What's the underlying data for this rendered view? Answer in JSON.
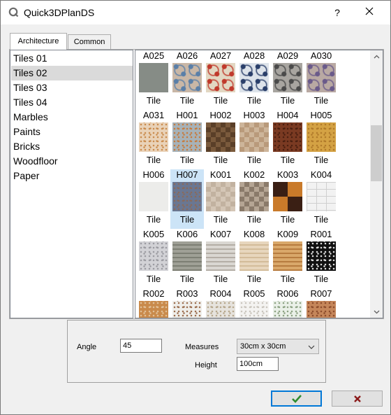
{
  "window": {
    "title": "Quick3DPlanDS",
    "help_label": "?"
  },
  "tabs": [
    {
      "label": "Architecture",
      "active": true
    },
    {
      "label": "Common",
      "active": false
    }
  ],
  "categories": [
    {
      "label": "Tiles 01",
      "selected": false
    },
    {
      "label": "Tiles 02",
      "selected": true
    },
    {
      "label": "Tiles 03",
      "selected": false
    },
    {
      "label": "Tiles 04",
      "selected": false
    },
    {
      "label": "Marbles",
      "selected": false
    },
    {
      "label": "Paints",
      "selected": false
    },
    {
      "label": "Bricks",
      "selected": false
    },
    {
      "label": "Woodfloor",
      "selected": false
    },
    {
      "label": "Paper",
      "selected": false
    }
  ],
  "grid": {
    "rows": [
      {
        "items": [
          {
            "code": "A025",
            "caption": "Tile",
            "color": "#868c86",
            "pattern": "plain",
            "selected": false
          },
          {
            "code": "A026",
            "caption": "Tile",
            "color": "#c9b7a6",
            "pattern": "ornate",
            "accent": "#5a7fa8",
            "selected": false
          },
          {
            "code": "A027",
            "caption": "Tile",
            "color": "#e2d7c2",
            "pattern": "ornate",
            "accent": "#c0392b",
            "selected": false
          },
          {
            "code": "A028",
            "caption": "Tile",
            "color": "#dde3ea",
            "pattern": "ornate",
            "accent": "#2a3f6a",
            "selected": false
          },
          {
            "code": "A029",
            "caption": "Tile",
            "color": "#a8a5a0",
            "pattern": "ornate",
            "accent": "#4a4a4a",
            "selected": false
          },
          {
            "code": "A030",
            "caption": "Tile",
            "color": "#b9a9a3",
            "pattern": "ornate",
            "accent": "#6a5a8a",
            "selected": false
          }
        ]
      },
      {
        "items": [
          {
            "code": "A031",
            "caption": "Tile",
            "color": "#e9d2b8",
            "pattern": "speckle",
            "accent": "#c98a4b",
            "selected": false
          },
          {
            "code": "H001",
            "caption": "Tile",
            "color": "#a7b2b8",
            "pattern": "speckle",
            "accent": "#c77a3c",
            "selected": false
          },
          {
            "code": "H002",
            "caption": "Tile",
            "color": "#7a5a3c",
            "pattern": "checker",
            "accent": "#5a3f28",
            "selected": false
          },
          {
            "code": "H003",
            "caption": "Tile",
            "color": "#cdb59a",
            "pattern": "checker",
            "accent": "#b99a7b",
            "selected": false
          },
          {
            "code": "H004",
            "caption": "Tile",
            "color": "#7a3a22",
            "pattern": "speckle",
            "accent": "#4a1f10",
            "selected": false
          },
          {
            "code": "H005",
            "caption": "Tile",
            "color": "#d4a244",
            "pattern": "speckle",
            "accent": "#b07a2a",
            "selected": false
          }
        ]
      },
      {
        "items": [
          {
            "code": "H006",
            "caption": "Tile",
            "color": "#ececea",
            "pattern": "plain",
            "selected": false
          },
          {
            "code": "H007",
            "caption": "Tile",
            "color": "#6a7792",
            "pattern": "speckle",
            "accent": "#8a6a5a",
            "selected": true
          },
          {
            "code": "K001",
            "caption": "Tile",
            "color": "#d4c6b6",
            "pattern": "checker",
            "accent": "#c2b2a0",
            "selected": false
          },
          {
            "code": "K002",
            "caption": "Tile",
            "color": "#b5a594",
            "pattern": "checker",
            "accent": "#8a7a6a",
            "selected": false
          },
          {
            "code": "K003",
            "caption": "Tile",
            "color": "#c97a2a",
            "pattern": "quad",
            "accent": "#3a1f14",
            "selected": false
          },
          {
            "code": "K004",
            "caption": "Tile",
            "color": "#f2f2f2",
            "pattern": "brick",
            "accent": "#cfcfcf",
            "selected": false
          }
        ]
      },
      {
        "items": [
          {
            "code": "K005",
            "caption": "Tile",
            "color": "#d2d2d6",
            "pattern": "speckle",
            "accent": "#9a9aa0",
            "selected": false
          },
          {
            "code": "K006",
            "caption": "Tile",
            "color": "#9fa096",
            "pattern": "stripes",
            "accent": "#7d7f74",
            "selected": false
          },
          {
            "code": "K007",
            "caption": "Tile",
            "color": "#dad7d2",
            "pattern": "stripes",
            "accent": "#b4aea6",
            "selected": false
          },
          {
            "code": "K008",
            "caption": "Tile",
            "color": "#e7d6bd",
            "pattern": "stripes",
            "accent": "#d3bc9a",
            "selected": false
          },
          {
            "code": "K009",
            "caption": "Tile",
            "color": "#d9a86a",
            "pattern": "stripes",
            "accent": "#b77c3f",
            "selected": false
          },
          {
            "code": "R001",
            "caption": "Tile",
            "color": "#111111",
            "pattern": "speckle",
            "accent": "#e5e5e5",
            "selected": false
          }
        ]
      },
      {
        "items": [
          {
            "code": "R002",
            "caption": "",
            "color": "#c98a4b",
            "pattern": "speckle",
            "accent": "#e2c29a",
            "selected": false
          },
          {
            "code": "R003",
            "caption": "",
            "color": "#efeeea",
            "pattern": "speckle",
            "accent": "#9a6a4a",
            "selected": false
          },
          {
            "code": "R004",
            "caption": "",
            "color": "#e6e3dd",
            "pattern": "speckle",
            "accent": "#b5a58a",
            "selected": false
          },
          {
            "code": "R005",
            "caption": "",
            "color": "#f4f3f1",
            "pattern": "speckle",
            "accent": "#c9c4bc",
            "selected": false
          },
          {
            "code": "R006",
            "caption": "",
            "color": "#eaf0e8",
            "pattern": "speckle",
            "accent": "#8aa080",
            "selected": false
          },
          {
            "code": "R007",
            "caption": "",
            "color": "#c5865a",
            "pattern": "speckle",
            "accent": "#8a4a2a",
            "selected": false
          }
        ]
      }
    ]
  },
  "properties": {
    "angle_label": "Angle",
    "angle_value": "45",
    "measures_label": "Measures",
    "measures_value": "30cm x 30cm",
    "height_label": "Height",
    "height_value": "100cm"
  },
  "buttons": {
    "ok_icon": "check-icon",
    "ok_color": "#2e8b2e",
    "cancel_icon": "cross-icon",
    "cancel_color": "#8b1a1a"
  },
  "colors": {
    "selection": "#cce4f7",
    "list_selection": "#dadada",
    "default_button_border": "#0078d7",
    "app_icon": "#6b6b6b"
  }
}
